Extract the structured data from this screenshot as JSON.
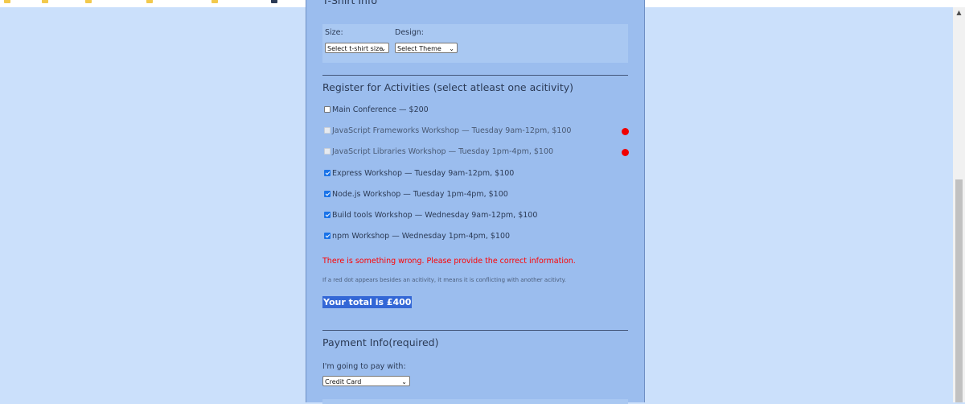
{
  "form": {
    "tshirt": {
      "heading": "T-Shirt Info",
      "size_label": "Size:",
      "size_selected": "Select t-shirt size",
      "design_label": "Design:",
      "design_selected": "Select Theme"
    },
    "activities": {
      "heading": "Register for Activities (select atleast one acitivity)",
      "items": [
        {
          "label": "Main Conference — $200",
          "checked": false,
          "disabled": false,
          "conflict": false
        },
        {
          "label": "JavaScript Frameworks Workshop — Tuesday 9am-12pm, $100",
          "checked": false,
          "disabled": true,
          "conflict": true
        },
        {
          "label": "JavaScript Libraries Workshop — Tuesday 1pm-4pm, $100",
          "checked": false,
          "disabled": true,
          "conflict": true
        },
        {
          "label": "Express Workshop — Tuesday 9am-12pm, $100",
          "checked": true,
          "disabled": false,
          "conflict": false
        },
        {
          "label": "Node.js Workshop — Tuesday 1pm-4pm, $100",
          "checked": true,
          "disabled": false,
          "conflict": false
        },
        {
          "label": "Build tools Workshop — Wednesday 9am-12pm, $100",
          "checked": true,
          "disabled": false,
          "conflict": false
        },
        {
          "label": "npm Workshop — Wednesday 1pm-4pm, $100",
          "checked": true,
          "disabled": false,
          "conflict": false
        }
      ],
      "error_message": "There is something wrong. Please provide the correct information.",
      "conflict_hint": "If a red dot appears besides an acitivity, it means it is conflicting with another acitivty.",
      "total": "Your total is £400"
    },
    "payment": {
      "heading": "Payment Info(required)",
      "method_label": "I'm going to pay with:",
      "method_selected": "Credit Card"
    }
  },
  "colors": {
    "page_background": "#cbe0fb",
    "panel_background": "#9bbdee",
    "error": "#ff0000",
    "conflict_dot": "#f00000",
    "selection_highlight": "#3367d6"
  },
  "icons": {
    "dropdown": "chevron-down-icon",
    "conflict": "red-dot-icon",
    "scroll_up": "scroll-up-arrow-icon"
  }
}
